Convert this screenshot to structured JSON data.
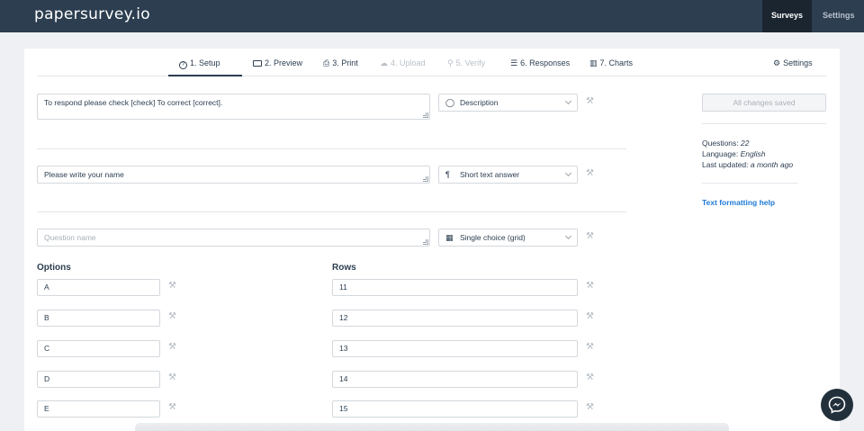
{
  "app": {
    "logo": "papersurvey.io"
  },
  "top_nav": {
    "surveys": "Surveys",
    "settings": "Settings"
  },
  "steps": [
    {
      "label": "1. Setup",
      "icon": "question-circle-icon",
      "glyph": "?",
      "state": "active"
    },
    {
      "label": "2. Preview",
      "icon": "monitor-icon",
      "glyph": "🖵",
      "state": "normal"
    },
    {
      "label": "3. Print",
      "icon": "printer-icon",
      "glyph": "⎙",
      "state": "normal"
    },
    {
      "label": "4. Upload",
      "icon": "cloud-upload-icon",
      "glyph": "☁",
      "state": "disabled"
    },
    {
      "label": "5. Verify",
      "icon": "user-check-icon",
      "glyph": "⚲",
      "state": "disabled"
    },
    {
      "label": "6. Responses",
      "icon": "list-icon",
      "glyph": "☰",
      "state": "normal"
    },
    {
      "label": "7. Charts",
      "icon": "bar-chart-icon",
      "glyph": "▥",
      "state": "normal"
    }
  ],
  "settings_link": {
    "label": "Settings",
    "icon": "gears-icon"
  },
  "questions": [
    {
      "text": "To respond please check [check] To correct [correct].",
      "placeholder": "",
      "type_label": "Description",
      "type_icon": "speech-bubble-icon",
      "type_glyph": "◯"
    },
    {
      "text": "Please write your name",
      "placeholder": "",
      "type_label": "Short text answer",
      "type_icon": "paragraph-icon",
      "type_glyph": "¶"
    },
    {
      "text": "",
      "placeholder": "Question name",
      "type_label": "Single choice (grid)",
      "type_icon": "grid-icon",
      "type_glyph": "▦"
    }
  ],
  "grid": {
    "options_heading": "Options",
    "rows_heading": "Rows",
    "options": [
      "A",
      "B",
      "C",
      "D",
      "E"
    ],
    "rows": [
      "11",
      "12",
      "13",
      "14",
      "15"
    ]
  },
  "sidebar": {
    "save_label": "All changes saved",
    "questions_label": "Questions:",
    "questions_value": "22",
    "language_label": "Language:",
    "language_value": "English",
    "updated_label": "Last updated:",
    "updated_value": "a month ago",
    "help_link": "Text formatting help"
  },
  "colors": {
    "topbar": "#2c3e50",
    "link": "#1f7ad6"
  }
}
